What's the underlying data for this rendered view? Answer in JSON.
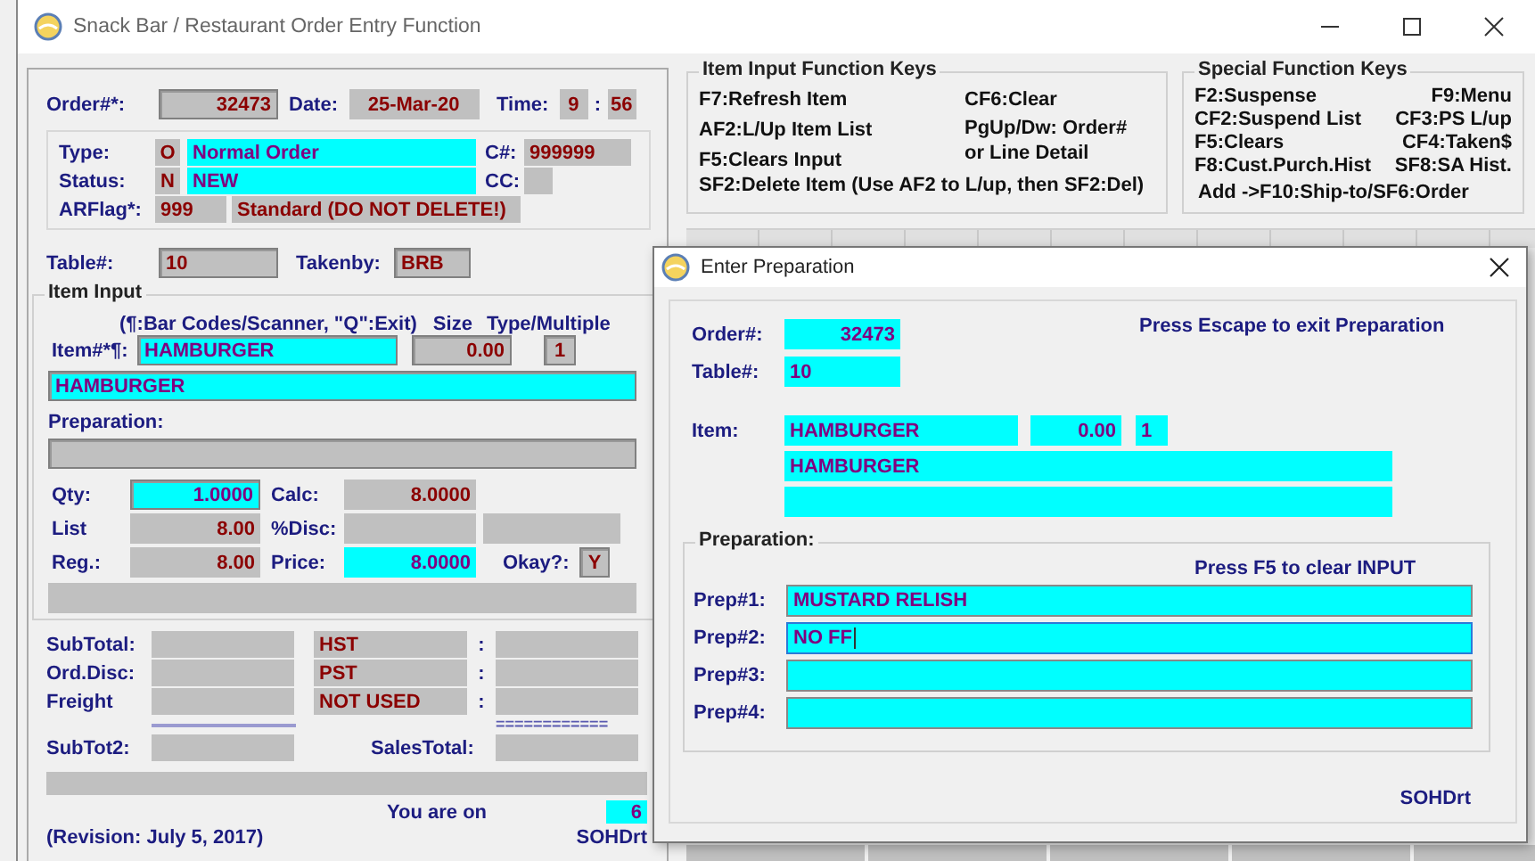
{
  "window": {
    "title": "Snack Bar / Restaurant Order Entry Function"
  },
  "order_header": {
    "order_label": "Order#*:",
    "order_no": "32473",
    "date_label": "Date:",
    "date": "25-Mar-20",
    "time_label": "Time:",
    "hour": "9",
    "time_sep": ":",
    "minute": "56"
  },
  "order_info": {
    "type_label": "Type:",
    "type_code": "O",
    "type_name": "Normal Order",
    "cnum_label": "C#:",
    "cnum": "999999",
    "status_label": "Status:",
    "status_code": "N",
    "status_name": "NEW",
    "cc_label": "CC:",
    "arflag_label": "ARFlag*:",
    "arflag": "999",
    "arflag_name": "Standard (DO NOT DELETE!)"
  },
  "table_row": {
    "table_label": "Table#:",
    "table": "10",
    "takenby_label": "Takenby:",
    "takenby": "BRB"
  },
  "item_input": {
    "legend": "Item Input",
    "hint": "(¶:Bar Codes/Scanner, \"Q\":Exit)",
    "size_label": "Size",
    "type_label": "Type/Multiple",
    "item_label": "Item#*¶:",
    "item": "HAMBURGER",
    "size": "0.00",
    "type": "1",
    "description": "HAMBURGER",
    "prep_label": "Preparation:",
    "qty_label": "Qty:",
    "qty": "1.0000",
    "calc_label": "Calc:",
    "calc": "8.0000",
    "list_label": "List",
    "list": "8.00",
    "disc_label": "%Disc:",
    "reg_label": "Reg.:",
    "reg": "8.00",
    "price_label": "Price:",
    "price": "8.0000",
    "okay_label": "Okay?:",
    "okay": "Y"
  },
  "totals": {
    "subtotal_label": "SubTotal:",
    "orddisc_label": "Ord.Disc:",
    "freight_label": "Freight",
    "taxes": [
      {
        "name": "HST",
        "sep": ":"
      },
      {
        "name": "PST",
        "sep": ":"
      },
      {
        "name": "NOT USED",
        "sep": ":"
      }
    ],
    "equals": "============",
    "subtot2_label": "SubTot2:",
    "salestotal_label": "SalesTotal:"
  },
  "footer": {
    "you_are_on_label": "You are on",
    "you_are_on": "6",
    "revision": "(Revision: July 5, 2017)",
    "form_id": "SOHDrt"
  },
  "item_keys": {
    "legend": "Item Input Function Keys",
    "left": [
      "F7:Refresh Item",
      "AF2:L/Up Item List",
      "F5:Clears Input"
    ],
    "right": [
      "CF6:Clear",
      "PgUp/Dw: Order# or Line Detail"
    ],
    "bottom": "SF2:Delete Item (Use AF2 to L/up, then SF2:Del)"
  },
  "special_keys": {
    "legend": "Special Function Keys",
    "rows": [
      {
        "left": "F2:Suspense",
        "right": "F9:Menu"
      },
      {
        "left": "CF2:Suspend List",
        "right": "CF3:PS L/up"
      },
      {
        "left": "F5:Clears",
        "right": "CF4:Taken$"
      },
      {
        "left": "F8:Cust.Purch.Hist",
        "right": "SF8:SA Hist."
      }
    ],
    "bottom": "Add ->F10:Ship-to/SF6:Order"
  },
  "dialog": {
    "title": "Enter Preparation",
    "order_label": "Order#:",
    "order": "32473",
    "escape_hint": "Press Escape to exit Preparation",
    "table_label": "Table#:",
    "table": "10",
    "item_label": "Item:",
    "item": "HAMBURGER",
    "size": "0.00",
    "type": "1",
    "description": "HAMBURGER",
    "prep_legend": "Preparation:",
    "clear_hint": "Press F5 to clear INPUT",
    "preps": [
      {
        "label": "Prep#1:",
        "value": "MUSTARD RELISH",
        "focused": false
      },
      {
        "label": "Prep#2:",
        "value": "NO FF",
        "focused": true
      },
      {
        "label": "Prep#3:",
        "focused": false
      },
      {
        "label": "Prep#4:",
        "focused": false
      }
    ],
    "form_id": "SOHDrt"
  }
}
